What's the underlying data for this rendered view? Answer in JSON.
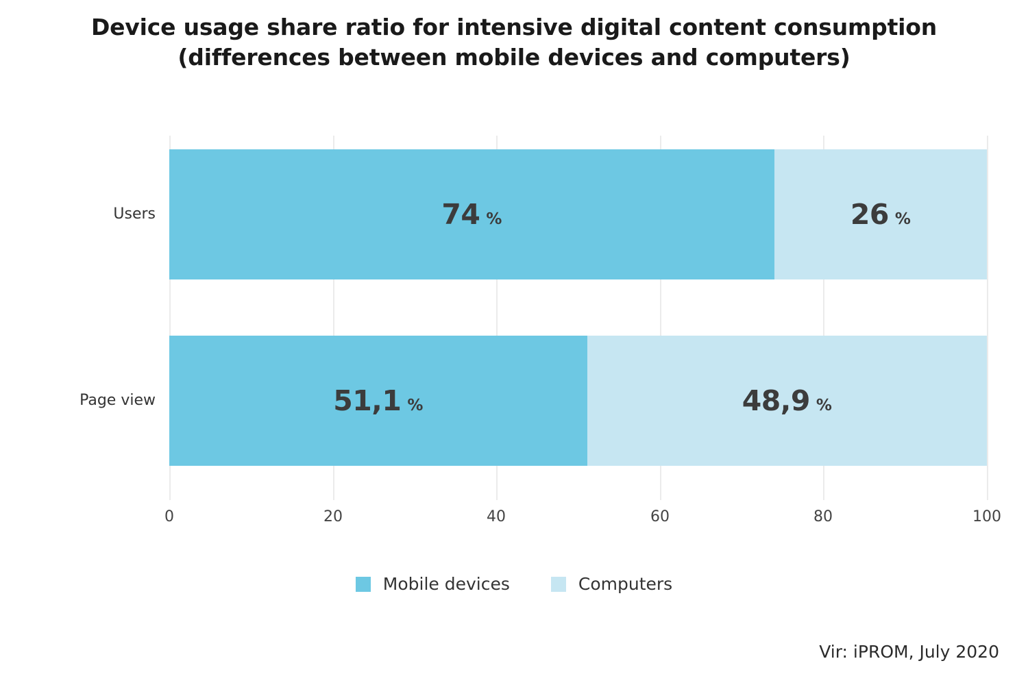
{
  "chart_data": {
    "type": "bar",
    "orientation": "horizontal",
    "stacked": true,
    "title_lines": [
      "Device usage share ratio for intensive digital content consumption",
      "(differences between mobile devices and computers)"
    ],
    "title": "Device usage share ratio for intensive digital content consumption (differences between mobile devices and computers)",
    "categories": [
      "Users",
      "Page view"
    ],
    "series": [
      {
        "name": "Mobile devices",
        "color": "#6DC8E3",
        "values": [
          74,
          51.1
        ],
        "labels": [
          "74",
          "51,1"
        ]
      },
      {
        "name": "Computers",
        "color": "#C6E6F2",
        "values": [
          26,
          48.9
        ],
        "labels": [
          "26",
          "48,9"
        ]
      }
    ],
    "value_suffix": "%",
    "xlabel": "",
    "ylabel": "",
    "xlim": [
      0,
      100
    ],
    "xticks": [
      "0",
      "20",
      "40",
      "60",
      "80",
      "100"
    ],
    "grid": true,
    "legend_position": "bottom"
  },
  "legend": {
    "items": [
      {
        "label": "Mobile devices",
        "color": "#6DC8E3"
      },
      {
        "label": "Computers",
        "color": "#C6E6F2"
      }
    ]
  },
  "source": {
    "text": "Vir: iPROM, July 2020"
  },
  "colors": {
    "mobile": "#6DC8E3",
    "computers": "#C6E6F2",
    "label_text": "#3c3c3c",
    "title_text": "#1a1a1a",
    "gridline": "#ebebeb",
    "background": "#ffffff"
  }
}
